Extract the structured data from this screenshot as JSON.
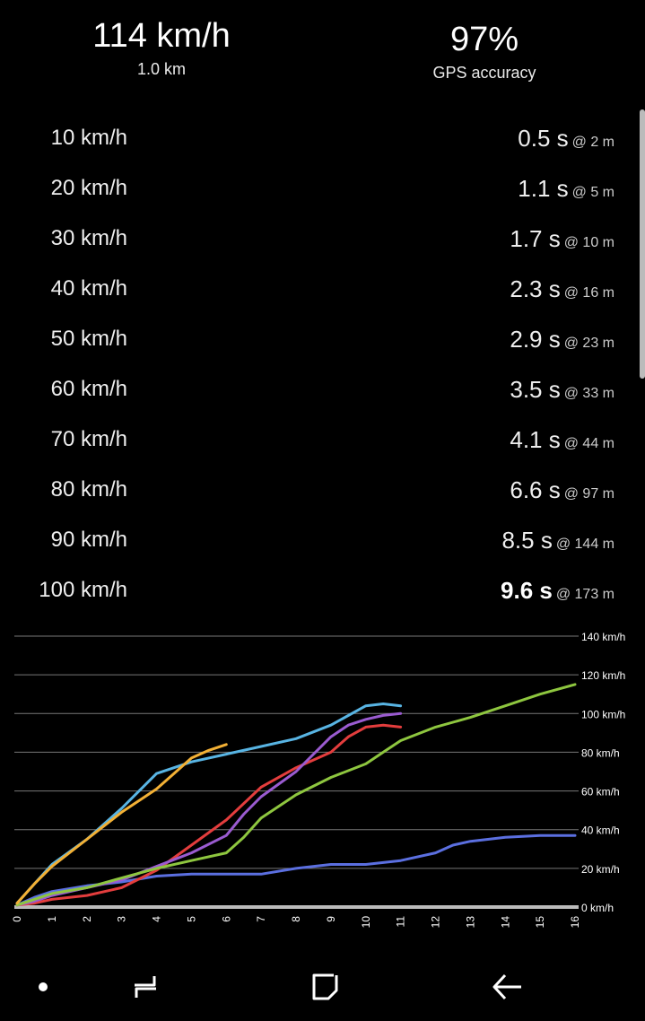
{
  "header": {
    "speed": "114 km/h",
    "distance": "1.0 km",
    "gps_value": "97%",
    "gps_label": "GPS accuracy"
  },
  "splits": [
    {
      "label": "10 km/h",
      "time": "0.5 s",
      "dist": "@ 2 m"
    },
    {
      "label": "20 km/h",
      "time": "1.1 s",
      "dist": "@ 5 m"
    },
    {
      "label": "30 km/h",
      "time": "1.7 s",
      "dist": "@ 10 m"
    },
    {
      "label": "40 km/h",
      "time": "2.3 s",
      "dist": "@ 16 m"
    },
    {
      "label": "50 km/h",
      "time": "2.9 s",
      "dist": "@ 23 m"
    },
    {
      "label": "60 km/h",
      "time": "3.5 s",
      "dist": "@ 33 m"
    },
    {
      "label": "70 km/h",
      "time": "4.1 s",
      "dist": "@ 44 m"
    },
    {
      "label": "80 km/h",
      "time": "6.6 s",
      "dist": "@ 97 m"
    },
    {
      "label": "90 km/h",
      "time": "8.5 s",
      "dist": "@ 144 m"
    },
    {
      "label": "100 km/h",
      "time": "9.6 s",
      "dist": "@ 173 m",
      "best": true
    }
  ],
  "chart_data": {
    "type": "line",
    "xlim": [
      0,
      16
    ],
    "ylim": [
      0,
      140
    ],
    "x_ticks": [
      "0",
      "1",
      "2",
      "3",
      "4",
      "5",
      "6",
      "7",
      "8",
      "9",
      "10",
      "11",
      "12",
      "13",
      "14",
      "15",
      "16"
    ],
    "y_ticks": [
      "0 km/h",
      "20 km/h",
      "40 km/h",
      "60 km/h",
      "80 km/h",
      "100 km/h",
      "120 km/h",
      "140 km/h"
    ],
    "y_tick_values": [
      0,
      20,
      40,
      60,
      80,
      100,
      120,
      140
    ],
    "grid": true,
    "series": [
      {
        "color": "#5b6fe0",
        "x": [
          0,
          0.5,
          1,
          2,
          3,
          4,
          5,
          6,
          7,
          8,
          9,
          10,
          11,
          12,
          12.5,
          13,
          14,
          15,
          16
        ],
        "y": [
          1,
          5,
          8,
          11,
          13,
          16,
          17,
          17,
          17,
          20,
          22,
          22,
          24,
          28,
          32,
          34,
          36,
          37,
          37
        ]
      },
      {
        "color": "#e33d3d",
        "x": [
          0,
          0.5,
          1,
          2,
          3,
          4,
          5,
          6,
          7,
          8,
          9,
          9.5,
          10,
          10.5,
          11
        ],
        "y": [
          1,
          2,
          4,
          6,
          10,
          19,
          32,
          45,
          62,
          72,
          80,
          88,
          93,
          94,
          93
        ]
      },
      {
        "color": "#9a5bd0",
        "x": [
          0,
          0.5,
          1,
          2,
          3,
          4,
          5,
          6,
          6.5,
          7,
          8,
          9,
          9.5,
          10,
          10.5,
          11
        ],
        "y": [
          1,
          3,
          6,
          10,
          14,
          21,
          28,
          37,
          48,
          57,
          70,
          88,
          94,
          97,
          99,
          100
        ]
      },
      {
        "color": "#8ec63f",
        "x": [
          0,
          1,
          2,
          3,
          4,
          5,
          6,
          6.5,
          7,
          8,
          9,
          10,
          10.5,
          11,
          12,
          13,
          14,
          15,
          16
        ],
        "y": [
          1,
          7,
          10,
          15,
          20,
          24,
          28,
          36,
          46,
          58,
          67,
          74,
          80,
          86,
          93,
          98,
          104,
          110,
          115
        ]
      },
      {
        "color": "#58b4e3",
        "x": [
          0,
          0.5,
          1,
          2,
          3,
          4,
          4.5,
          5,
          6,
          7,
          8,
          9,
          10,
          10.5,
          11
        ],
        "y": [
          2,
          12,
          22,
          35,
          51,
          69,
          72,
          75,
          79,
          83,
          87,
          94,
          104,
          105,
          104
        ]
      },
      {
        "color": "#f2b035",
        "x": [
          0,
          0.5,
          1,
          2,
          3,
          4,
          4.5,
          5,
          5.5,
          6
        ],
        "y": [
          2,
          12,
          21,
          35,
          49,
          61,
          69,
          77,
          81,
          84
        ]
      }
    ]
  },
  "nav": {
    "recents_icon": "recents-icon",
    "home_icon": "home-icon",
    "back_icon": "back-icon"
  }
}
